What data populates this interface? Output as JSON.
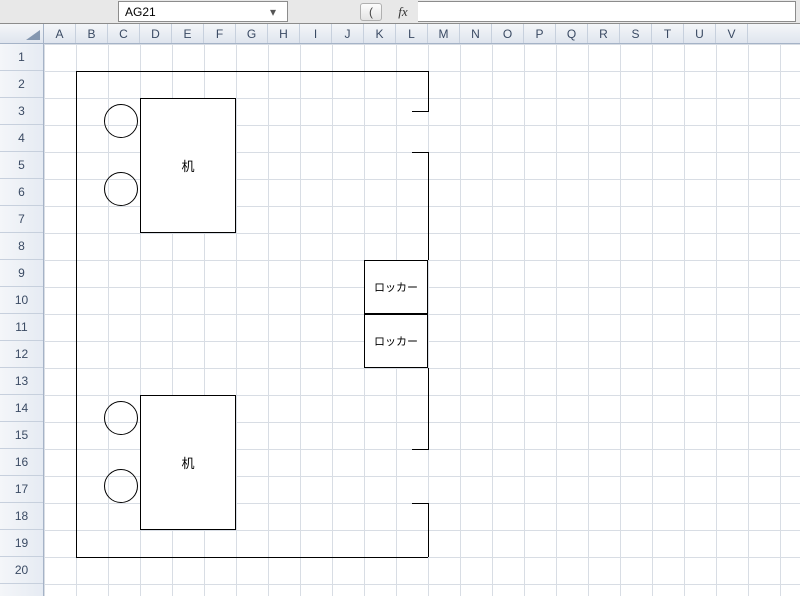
{
  "formula_bar": {
    "name_box_value": "AG21",
    "fx_label": "fx",
    "formula_value": ""
  },
  "columns": [
    "A",
    "B",
    "C",
    "D",
    "E",
    "F",
    "G",
    "H",
    "I",
    "J",
    "K",
    "L",
    "M",
    "N",
    "O",
    "P",
    "Q",
    "R",
    "S",
    "T",
    "U",
    "V"
  ],
  "row_count": 20,
  "shapes": {
    "desk1_label": "机",
    "desk2_label": "机",
    "locker1_label": "ロッカー",
    "locker2_label": "ロッカー"
  },
  "icons": {
    "dropdown": "▾",
    "cancel": "✕",
    "confirm": "✓"
  }
}
